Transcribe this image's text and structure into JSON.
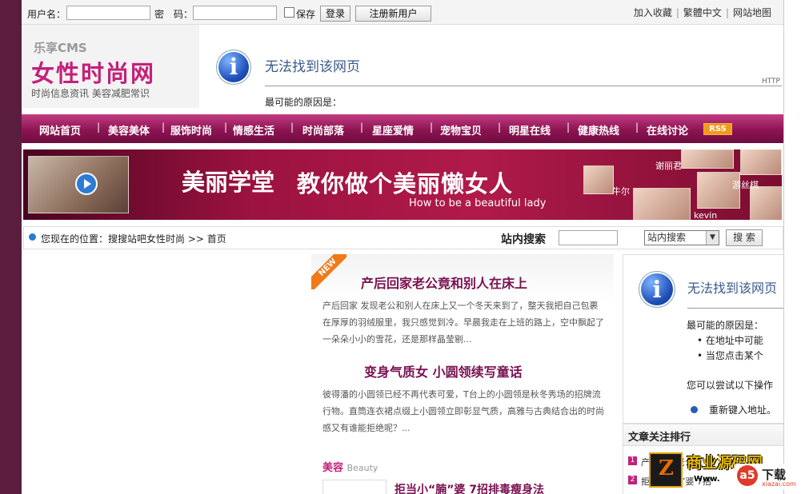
{
  "topbar": {
    "username_label": "用户名：",
    "password_label": "密　码：",
    "remember_label": "保存",
    "login_button": "登录",
    "register_button": "注册新用户",
    "links": [
      "加入收藏",
      "繁體中文",
      "网站地图"
    ]
  },
  "logo": {
    "cms": "乐享CMS",
    "name": "女性时尚网",
    "slogan": "时尚信息资讯  美容减肥常识"
  },
  "header_error": {
    "title": "无法找到该网页",
    "http": "HTTP",
    "reason": "最可能的原因是："
  },
  "nav": {
    "items": [
      "网站首页",
      "美容美体",
      "服饰时尚",
      "情感生活",
      "时尚部落",
      "星座爱情",
      "宠物宝贝",
      "明星在线",
      "健康热线",
      "在线讨论"
    ],
    "rss": "RSS"
  },
  "banner": {
    "title_a": "美丽学堂",
    "title_b": "教你做个美丽懒女人",
    "subtitle": "How to be a beautiful lady",
    "names": [
      "谢丽君",
      "牛尔",
      "游丝棋",
      "kevin"
    ]
  },
  "location": {
    "prefix": "您现在的位置：",
    "path": "搜搜站吧女性时尚 >> 首页",
    "search_label": "站内搜索",
    "search_option": "站内搜索",
    "search_button": "搜 索"
  },
  "featured": {
    "badge": "NEW",
    "article1_title": "产后回家老公竟和别人在床上",
    "article1_excerpt": "产后回家 发现老公和别人在床上又一个冬天来到了，整天我把自己包裹在厚厚的羽绒服里，我只感觉到冷。早晨我走在上班的路上，空中飘起了一朵朵小小的雪花，还是那样晶莹剔...",
    "article2_title": "变身气质女  小圆领续写童话",
    "article2_excerpt": "彼得潘的小圆领已经不再代表可爱，T台上的小圆领是秋冬秀场的招牌流行物。直筒连衣裙点缀上小圆领立即彰显气质，高雅与古典结合出的时尚感又有谁能拒绝呢？...",
    "section_title": "美容",
    "section_sub": "Beauty",
    "article3_title": "拒当小“腩”婆  7招排毒瘦身法"
  },
  "right_error": {
    "title": "无法找到该网页",
    "reason": "最可能的原因是：",
    "bullet1": "在地址中可能",
    "bullet2": "当您点击某个",
    "try": "您可以尝试以下操作",
    "retype": "重新键入地址。"
  },
  "ranking": {
    "title": "文章关注排行",
    "items": [
      "产后回家老公竟",
      "拒当小“腩”婆  7招"
    ]
  },
  "watermark": {
    "z": "Z",
    "brand": "商业源码网",
    "www": "Www.",
    "a5": "下载",
    "a5_site": "xiazai.com"
  }
}
